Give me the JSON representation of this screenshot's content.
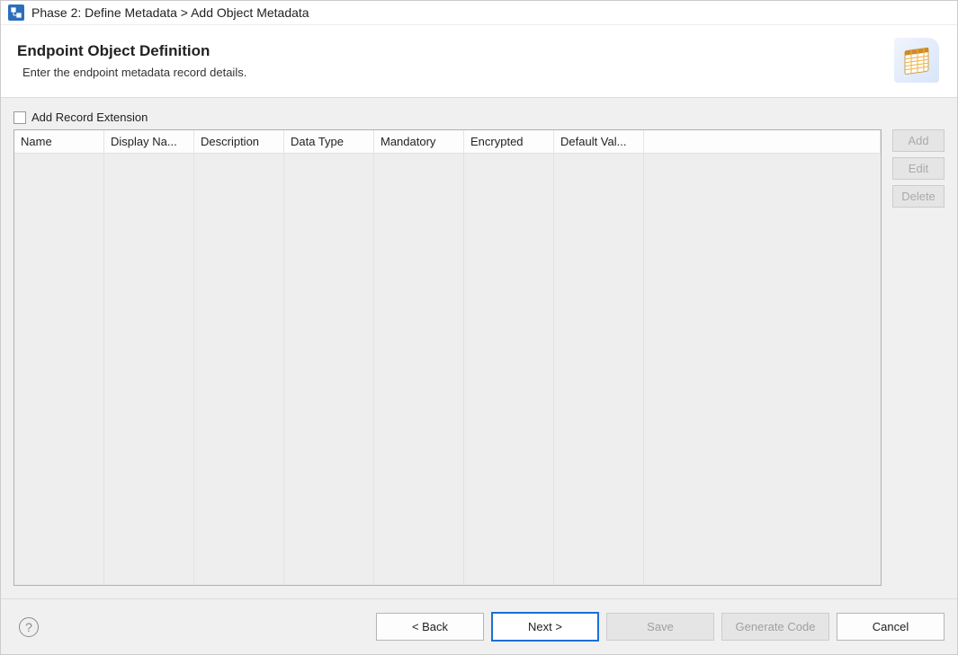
{
  "window": {
    "title": "Phase 2: Define Metadata > Add Object Metadata"
  },
  "header": {
    "title": "Endpoint Object Definition",
    "description": "Enter the endpoint metadata record details."
  },
  "content": {
    "checkbox_label": "Add Record Extension",
    "checkbox_checked": false,
    "table": {
      "columns": {
        "name": "Name",
        "display": "Display Na...",
        "description": "Description",
        "data_type": "Data Type",
        "mandatory": "Mandatory",
        "encrypted": "Encrypted",
        "default_value": "Default Val..."
      },
      "rows": []
    },
    "side_buttons": {
      "add": "Add",
      "edit": "Edit",
      "delete": "Delete"
    }
  },
  "footer": {
    "back": "< Back",
    "next": "Next >",
    "save": "Save",
    "generate_code": "Generate Code",
    "cancel": "Cancel"
  }
}
